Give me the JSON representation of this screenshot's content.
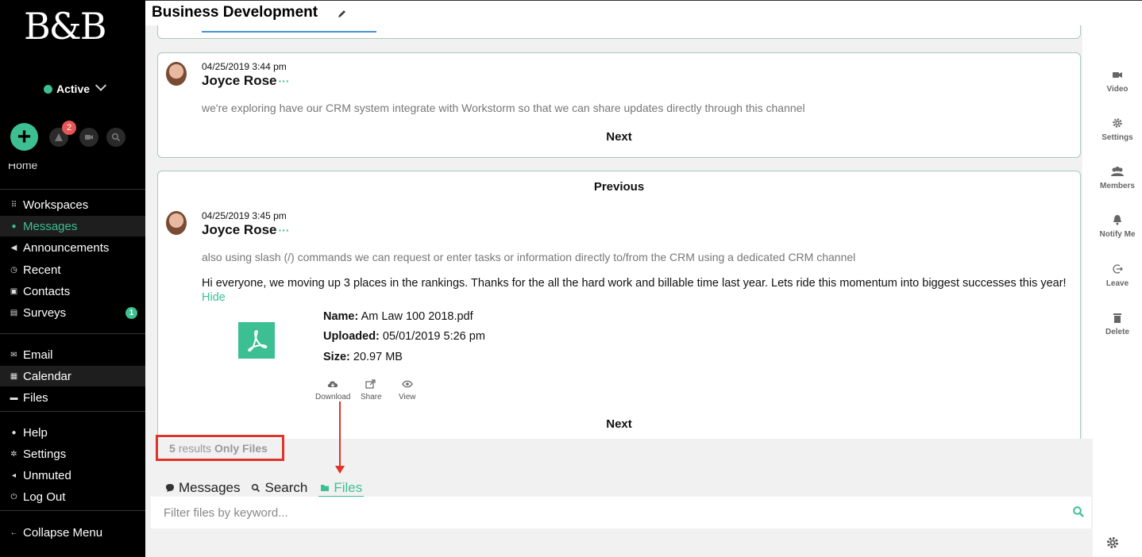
{
  "app": {
    "logo_text": "B&B",
    "status_label": "Active",
    "notification_count": "2"
  },
  "sidebar": {
    "cut_item": "Home",
    "groups": [
      [
        {
          "label": "Workspaces",
          "icon": "grid-icon"
        },
        {
          "label": "Messages",
          "icon": "chat-icon"
        },
        {
          "label": "Announcements",
          "icon": "megaphone-icon"
        },
        {
          "label": "Recent",
          "icon": "clock-icon"
        },
        {
          "label": "Contacts",
          "icon": "contact-card-icon"
        },
        {
          "label": "Surveys",
          "icon": "clipboard-icon",
          "badge": "1"
        }
      ],
      [
        {
          "label": "Email",
          "icon": "envelope-icon"
        },
        {
          "label": "Calendar",
          "icon": "calendar-icon"
        },
        {
          "label": "Files",
          "icon": "folder-icon"
        }
      ],
      [
        {
          "label": "Help",
          "icon": "info-icon"
        },
        {
          "label": "Settings",
          "icon": "gear-icon"
        },
        {
          "label": "Unmuted",
          "icon": "speaker-icon"
        },
        {
          "label": "Log Out",
          "icon": "power-icon"
        }
      ],
      [
        {
          "label": "Collapse Menu",
          "icon": "arrow-left-icon"
        }
      ]
    ]
  },
  "header": {
    "title": "Business Development"
  },
  "messages": [
    {
      "timestamp": "04/25/2019 3:44 pm",
      "author": "Joyce Rose",
      "more": "···",
      "text": "we're exploring have our CRM system integrate with Workstorm so that we can share updates directly through this channel",
      "next_label": "Next"
    },
    {
      "previous_label": "Previous",
      "timestamp": "04/25/2019 3:45 pm",
      "author": "Joyce Rose",
      "more": "···",
      "text": "also using slash (/) commands we can request or enter tasks or information directly to/from the CRM using a dedicated CRM channel",
      "body": "Hi everyone, we moving up 3 places in the rankings.  Thanks for the all the hard work and billable time last year.  Lets ride this momentum into biggest successes this year!",
      "hide_label": "Hide",
      "file": {
        "name_label": "Name:",
        "name": "Am Law 100 2018.pdf",
        "uploaded_label": "Uploaded:",
        "uploaded": "05/01/2019 5:26 pm",
        "size_label": "Size:",
        "size": "20.97 MB",
        "actions": [
          "Download",
          "Share",
          "View"
        ]
      },
      "next_label": "Next"
    }
  ],
  "rail": [
    {
      "label": "Video",
      "icon": "video-camera-icon"
    },
    {
      "label": "Settings",
      "icon": "gear-icon"
    },
    {
      "label": "Members",
      "icon": "members-icon"
    },
    {
      "label": "Notify Me",
      "icon": "bell-icon"
    },
    {
      "label": "Leave",
      "icon": "leave-icon"
    },
    {
      "label": "Delete",
      "icon": "trash-icon"
    }
  ],
  "results": {
    "count": "5",
    "word": "results",
    "filter": "Only Files"
  },
  "tabs": [
    {
      "label": "Messages",
      "icon": "chat-icon"
    },
    {
      "label": "Search",
      "icon": "search-icon"
    },
    {
      "label": "Files",
      "icon": "folder-icon",
      "active": true
    }
  ],
  "filter": {
    "placeholder": "Filter files by keyword..."
  },
  "colors": {
    "accent": "#3dbf94",
    "highlight": "#e0332a",
    "sidebar_bg": "#000000"
  }
}
